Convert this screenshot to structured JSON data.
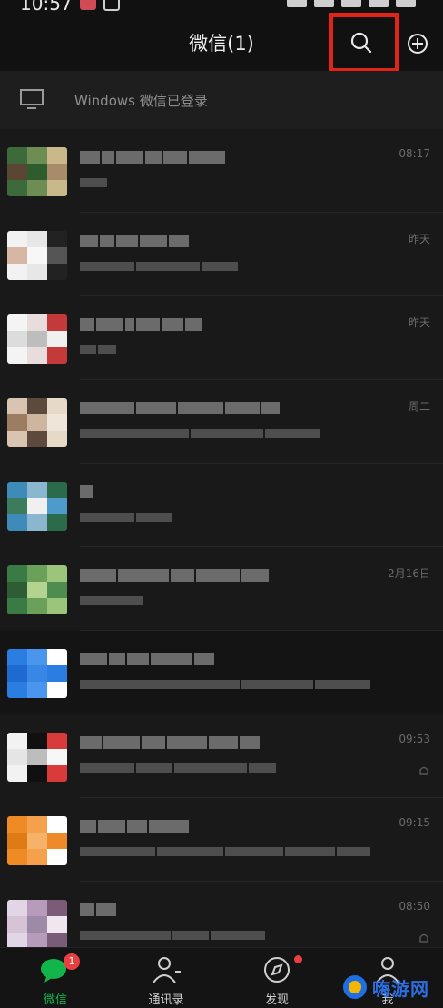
{
  "status": {
    "time": "10:57"
  },
  "header": {
    "title": "微信(1)"
  },
  "device": {
    "label": "Windows 微信已登录"
  },
  "chats": [
    {
      "time": "08:17",
      "avatar": [
        "#3c6a3a",
        "#6e8d55",
        "#c9b98a",
        "#5a4632",
        "#2d5c2f",
        "#a88c6a"
      ]
    },
    {
      "time": "昨天",
      "avatar": [
        "#f2f2f2",
        "#e7e7e7",
        "#222222",
        "#d6b7a5",
        "#f7f7f7",
        "#555555"
      ]
    },
    {
      "time": "昨天",
      "avatar": [
        "#f4f4f4",
        "#e8dcdc",
        "#c43a3a",
        "#dcdcdc",
        "#bdbdbd",
        "#f0f0f0"
      ]
    },
    {
      "time": "周二",
      "avatar": [
        "#d8c4b0",
        "#5e4a3c",
        "#e6d9c8",
        "#9c7d62",
        "#cdb59e",
        "#efe5d8"
      ]
    },
    {
      "time": "",
      "avatar": [
        "#3e8ab8",
        "#8bb6d0",
        "#2b6a4a",
        "#3a7c5c",
        "#f0f0f0",
        "#4d9acb"
      ]
    },
    {
      "time": "2月16日",
      "avatar": [
        "#3a7a44",
        "#6aa05a",
        "#9cc47a",
        "#2e5c36",
        "#b3d38e",
        "#4e8c50"
      ]
    },
    {
      "time": "",
      "avatar": [
        "#2a7de1",
        "#4a95ee",
        "#ffffff",
        "#1e6ad0",
        "#3887e6",
        "#2a7de1"
      ]
    },
    {
      "time": "09:53",
      "avatar": [
        "#f2f2f2",
        "#101010",
        "#d93b3b",
        "#e5e5e5",
        "#bdbdbd",
        "#f7f7f7"
      ]
    },
    {
      "time": "09:15",
      "avatar": [
        "#f08a24",
        "#f5a04a",
        "#ffffff",
        "#e07a14",
        "#f6b26b",
        "#ee8a2a"
      ]
    },
    {
      "time": "08:50",
      "avatar": [
        "#e2d6e6",
        "#b79bbd",
        "#7a5c78",
        "#d6c3d6",
        "#9c8aa6",
        "#efe6ef"
      ]
    }
  ],
  "tabs": [
    {
      "label": "微信",
      "badge": "1"
    },
    {
      "label": "通讯录"
    },
    {
      "label": "发现"
    },
    {
      "label": "我"
    }
  ],
  "watermark": {
    "text": "嗨游网"
  },
  "colors": {
    "accent": "#11b54a",
    "highlight": "#e02418",
    "badge": "#e84040"
  }
}
